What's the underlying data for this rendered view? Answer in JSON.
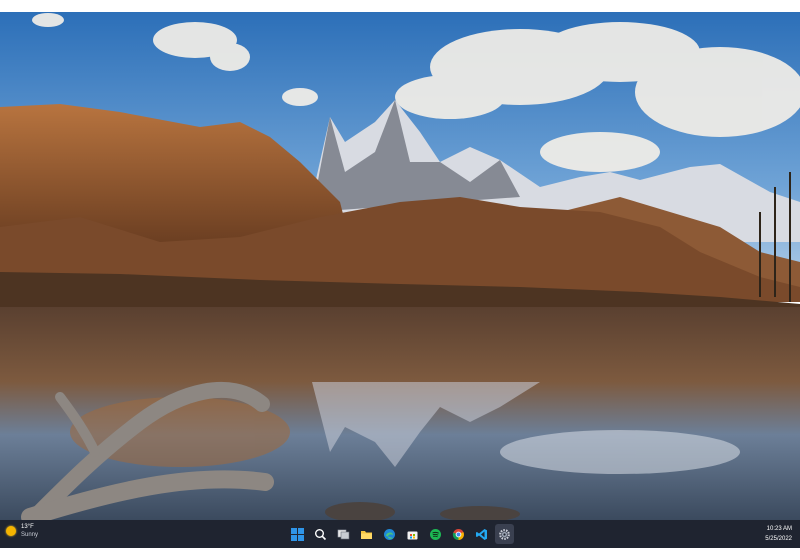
{
  "weather": {
    "temperature": "13°F",
    "condition": "Sunny",
    "icon": "sun-icon"
  },
  "taskbar": {
    "apps": [
      {
        "name": "start",
        "icon": "windows-start-icon"
      },
      {
        "name": "search",
        "icon": "search-icon"
      },
      {
        "name": "task-view",
        "icon": "task-view-icon"
      },
      {
        "name": "file-explorer",
        "icon": "folder-icon"
      },
      {
        "name": "edge",
        "icon": "edge-browser-icon"
      },
      {
        "name": "store",
        "icon": "store-icon"
      },
      {
        "name": "spotify",
        "icon": "spotify-icon"
      },
      {
        "name": "chrome",
        "icon": "chrome-icon"
      },
      {
        "name": "vscode",
        "icon": "vscode-icon"
      },
      {
        "name": "settings",
        "icon": "gear-icon"
      }
    ]
  },
  "clock": {
    "time": "10:23 AM",
    "date": "5/25/2022"
  },
  "colors": {
    "taskbar": "#1f2430",
    "accent": "#0078d4"
  }
}
